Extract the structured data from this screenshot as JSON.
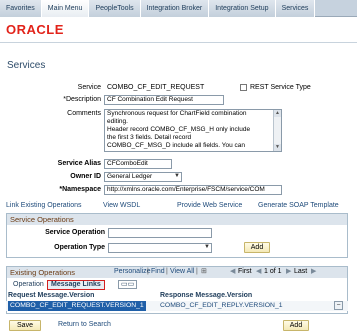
{
  "nav": {
    "tabs": [
      "Favorites",
      "Main Menu",
      "PeopleTools",
      "Integration Broker",
      "Integration Setup",
      "Services"
    ]
  },
  "logo": {
    "text": "ORACLE",
    "color": "#e2231a"
  },
  "page": {
    "title": "Services"
  },
  "form": {
    "service_label": "Service",
    "service_value": "COMBO_CF_EDIT_REQUEST",
    "rest_label": "REST Service Type",
    "description_label": "*Description",
    "description_value": "CF Combination Edit Request",
    "comments_label": "Comments",
    "comments_lines": [
      "Synchronous request for ChartField combination",
      "editing.",
      "Header record COMBO_CF_MSG_H only include",
      "the first 3 fields.  Detail record",
      "COMBO_CF_MSG_D include all fields.  You can"
    ],
    "alias_label": "Service Alias",
    "alias_value": "CFComboEdit",
    "owner_label": "Owner ID",
    "owner_value": "General Ledger",
    "namespace_label": "*Namespace",
    "namespace_value": "http://xmlns.oracle.com/Enterprise/FSCM/service/COM"
  },
  "links": {
    "link_existing": "Link Existing Operations",
    "view_wsdl": "View WSDL",
    "provide_web": "Provide Web Service",
    "generate_soap": "Generate SOAP Template"
  },
  "service_operations": {
    "header": "Service Operations",
    "service_operation_label": "Service Operation",
    "operation_type_label": "Operation Type",
    "add_label": "Add"
  },
  "existing_operations": {
    "header": "Existing Operations",
    "personalize": "Personalize",
    "find": "Find",
    "view_all": "View All",
    "first": "First",
    "pager": "1 of 1",
    "last": "Last",
    "sep": "|",
    "tab_operation": "Operation",
    "tab_message_links": "Message Links",
    "col_request": "Request Message.Version",
    "col_response": "Response Message.Version",
    "row_request": "COMBO_CF_EDIT_REQUEST.VERSION_1",
    "row_response": "COMBO_CF_EDIT_REPLY.VERSION_1",
    "minus": "−"
  },
  "footer": {
    "save": "Save",
    "return": "Return to Search",
    "add": "Add"
  }
}
